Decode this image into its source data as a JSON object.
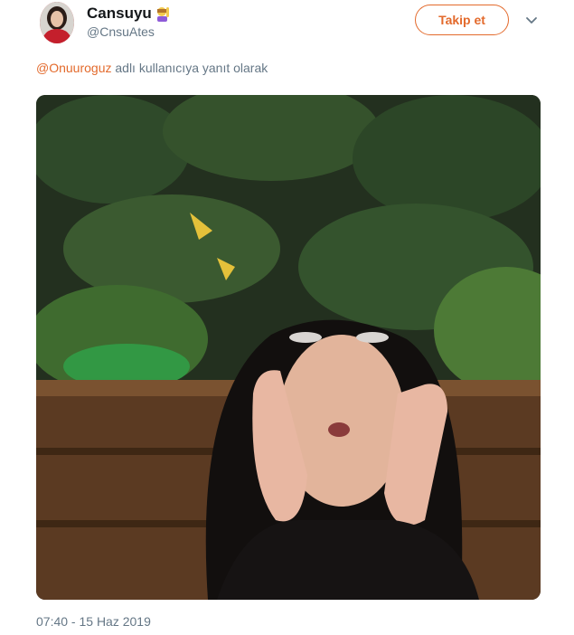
{
  "tweet": {
    "display_name": "Cansuyu",
    "handle": "@CnsuAtes",
    "follow_label": "Takip et",
    "reply_mention": "@Onuuroguz",
    "reply_text": " adlı kullanıcıya yanıt olarak",
    "timestamp": "07:40 - 15 Haz 2019"
  },
  "icons": {
    "emoji": "woman-raising-hand-emoji",
    "menu": "chevron-down-icon"
  },
  "colors": {
    "accent": "#e36a2c",
    "secondary_text": "#657786",
    "primary_text": "#14171a"
  }
}
